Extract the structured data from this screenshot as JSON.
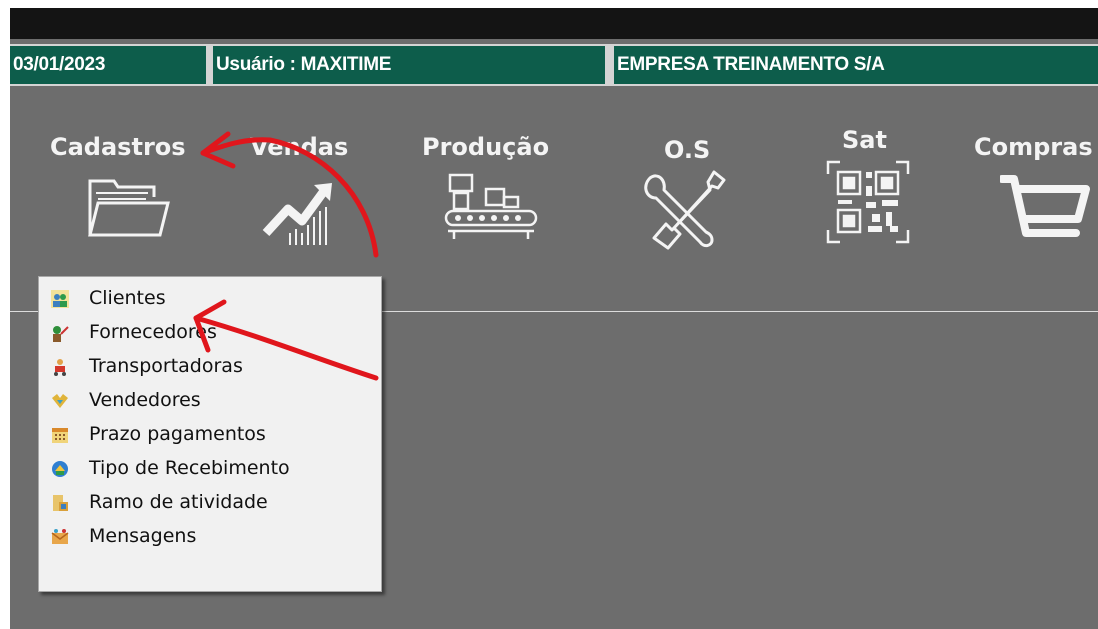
{
  "statusbar": {
    "date": "03/01/2023",
    "user": "Usuário : MAXITIME",
    "company": "EMPRESA TREINAMENTO S/A"
  },
  "menu": [
    {
      "label": "Cadastros",
      "icon": "folder-icon"
    },
    {
      "label": "Vendas",
      "icon": "sales-chart-icon"
    },
    {
      "label": "Produção",
      "icon": "conveyor-icon"
    },
    {
      "label": "O.S",
      "icon": "tools-icon"
    },
    {
      "label": "Sat",
      "icon": "qr-code-icon"
    },
    {
      "label": "Compras",
      "icon": "cart-icon"
    }
  ],
  "dropdown": [
    {
      "label": "Clientes",
      "icon": "clients-icon"
    },
    {
      "label": "Fornecedores",
      "icon": "suppliers-icon"
    },
    {
      "label": "Transportadoras",
      "icon": "carriers-icon"
    },
    {
      "label": "Vendedores",
      "icon": "sellers-icon"
    },
    {
      "label": "Prazo pagamentos",
      "icon": "calendar-icon"
    },
    {
      "label": "Tipo de Recebimento",
      "icon": "receipt-type-icon"
    },
    {
      "label": "Ramo de atividade",
      "icon": "activity-icon"
    },
    {
      "label": "Mensagens",
      "icon": "messages-icon"
    }
  ],
  "colors": {
    "background": "#6d6d6d",
    "status_green": "#0d5d4b",
    "annotation_red": "#e0161c"
  }
}
